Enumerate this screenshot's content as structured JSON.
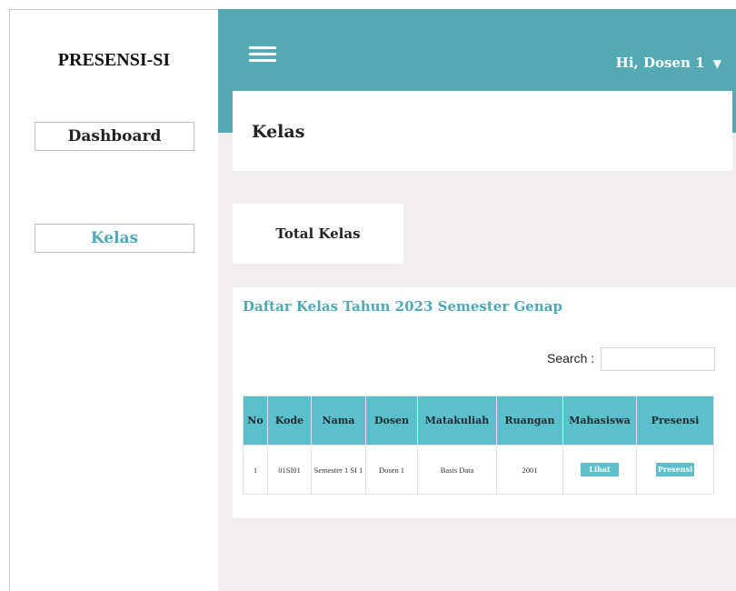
{
  "sidebar": {
    "brand": "PRESENSI-SI",
    "items": [
      {
        "label": "Dashboard"
      },
      {
        "label": "Kelas"
      }
    ]
  },
  "header": {
    "user_greeting": "Hi, Dosen 1",
    "caret": "▼",
    "menu_icon": "hamburger-icon"
  },
  "page": {
    "title": "Kelas",
    "stat_card_label": "Total Kelas"
  },
  "table_section": {
    "title": "Daftar Kelas Tahun 2023 Semester Genap",
    "search_label": "Search :",
    "search_value": "",
    "columns": [
      "No",
      "Kode",
      "Nama",
      "Dosen",
      "Matakuliah",
      "Ruangan",
      "Mahasiswa",
      "Presensi"
    ],
    "rows": [
      {
        "no": "1",
        "kode": "01SI01",
        "nama": "Semester 1 SI 1",
        "dosen": "Dosen 1",
        "matakuliah": "Basis Data",
        "ruangan": "2001",
        "mahasiswa_action": "Lihat",
        "presensi_action": "Presensi"
      }
    ]
  },
  "colors": {
    "accent": "#55a9b3",
    "table_header": "#5bc0cc",
    "background": "#f1eeed"
  }
}
